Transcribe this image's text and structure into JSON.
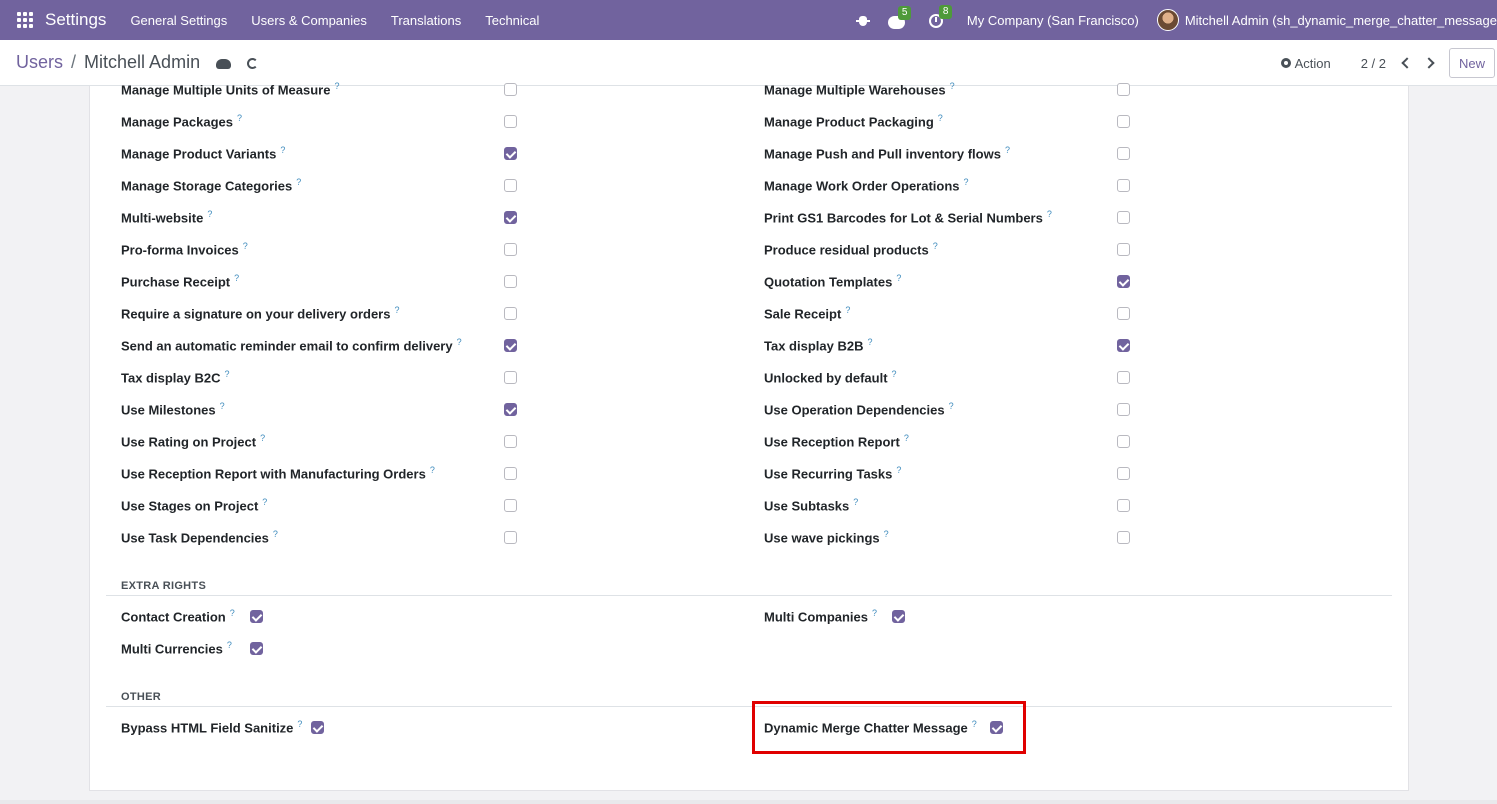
{
  "navbar": {
    "app_title": "Settings",
    "menu": [
      "General Settings",
      "Users & Companies",
      "Translations",
      "Technical"
    ],
    "messages_count": "5",
    "activities_count": "8",
    "company": "My Company (San Francisco)",
    "user": "Mitchell Admin (sh_dynamic_merge_chatter_message"
  },
  "control_panel": {
    "breadcrumb_parent": "Users",
    "breadcrumb_separator": "/",
    "breadcrumb_current": "Mitchell Admin",
    "action_label": "Action",
    "pager": "2 / 2",
    "new_label": "New"
  },
  "technical_rights": {
    "left": [
      {
        "label": "Manage Multiple Units of Measure",
        "checked": false
      },
      {
        "label": "Manage Packages",
        "checked": false
      },
      {
        "label": "Manage Product Variants",
        "checked": true
      },
      {
        "label": "Manage Storage Categories",
        "checked": false
      },
      {
        "label": "Multi-website",
        "checked": true
      },
      {
        "label": "Pro-forma Invoices",
        "checked": false
      },
      {
        "label": "Purchase Receipt",
        "checked": false
      },
      {
        "label": "Require a signature on your delivery orders",
        "checked": false
      },
      {
        "label": "Send an automatic reminder email to confirm delivery",
        "checked": true
      },
      {
        "label": "Tax display B2C",
        "checked": false
      },
      {
        "label": "Use Milestones",
        "checked": true
      },
      {
        "label": "Use Rating on Project",
        "checked": false
      },
      {
        "label": "Use Reception Report with Manufacturing Orders",
        "checked": false
      },
      {
        "label": "Use Stages on Project",
        "checked": false
      },
      {
        "label": "Use Task Dependencies",
        "checked": false
      }
    ],
    "right": [
      {
        "label": "Manage Multiple Warehouses",
        "checked": false
      },
      {
        "label": "Manage Product Packaging",
        "checked": false
      },
      {
        "label": "Manage Push and Pull inventory flows",
        "checked": false
      },
      {
        "label": "Manage Work Order Operations",
        "checked": false
      },
      {
        "label": "Print GS1 Barcodes for Lot & Serial Numbers",
        "checked": false
      },
      {
        "label": "Produce residual products",
        "checked": false
      },
      {
        "label": "Quotation Templates",
        "checked": true
      },
      {
        "label": "Sale Receipt",
        "checked": false
      },
      {
        "label": "Tax display B2B",
        "checked": true
      },
      {
        "label": "Unlocked by default",
        "checked": false
      },
      {
        "label": "Use Operation Dependencies",
        "checked": false
      },
      {
        "label": "Use Reception Report",
        "checked": false
      },
      {
        "label": "Use Recurring Tasks",
        "checked": false
      },
      {
        "label": "Use Subtasks",
        "checked": false
      },
      {
        "label": "Use wave pickings",
        "checked": false
      }
    ]
  },
  "extra_rights": {
    "title": "EXTRA RIGHTS",
    "left": [
      {
        "label": "Contact Creation",
        "checked": true
      },
      {
        "label": "Multi Currencies",
        "checked": true
      }
    ],
    "right": [
      {
        "label": "Multi Companies",
        "checked": true
      }
    ]
  },
  "other": {
    "title": "OTHER",
    "left": [
      {
        "label": "Bypass HTML Field Sanitize",
        "checked": true
      }
    ],
    "right": [
      {
        "label": "Dynamic Merge Chatter Message",
        "checked": true
      }
    ]
  },
  "help_marker": "?",
  "colors": {
    "brand": "#71639e",
    "highlight": "#e00000",
    "badge": "#4e9a3a"
  }
}
